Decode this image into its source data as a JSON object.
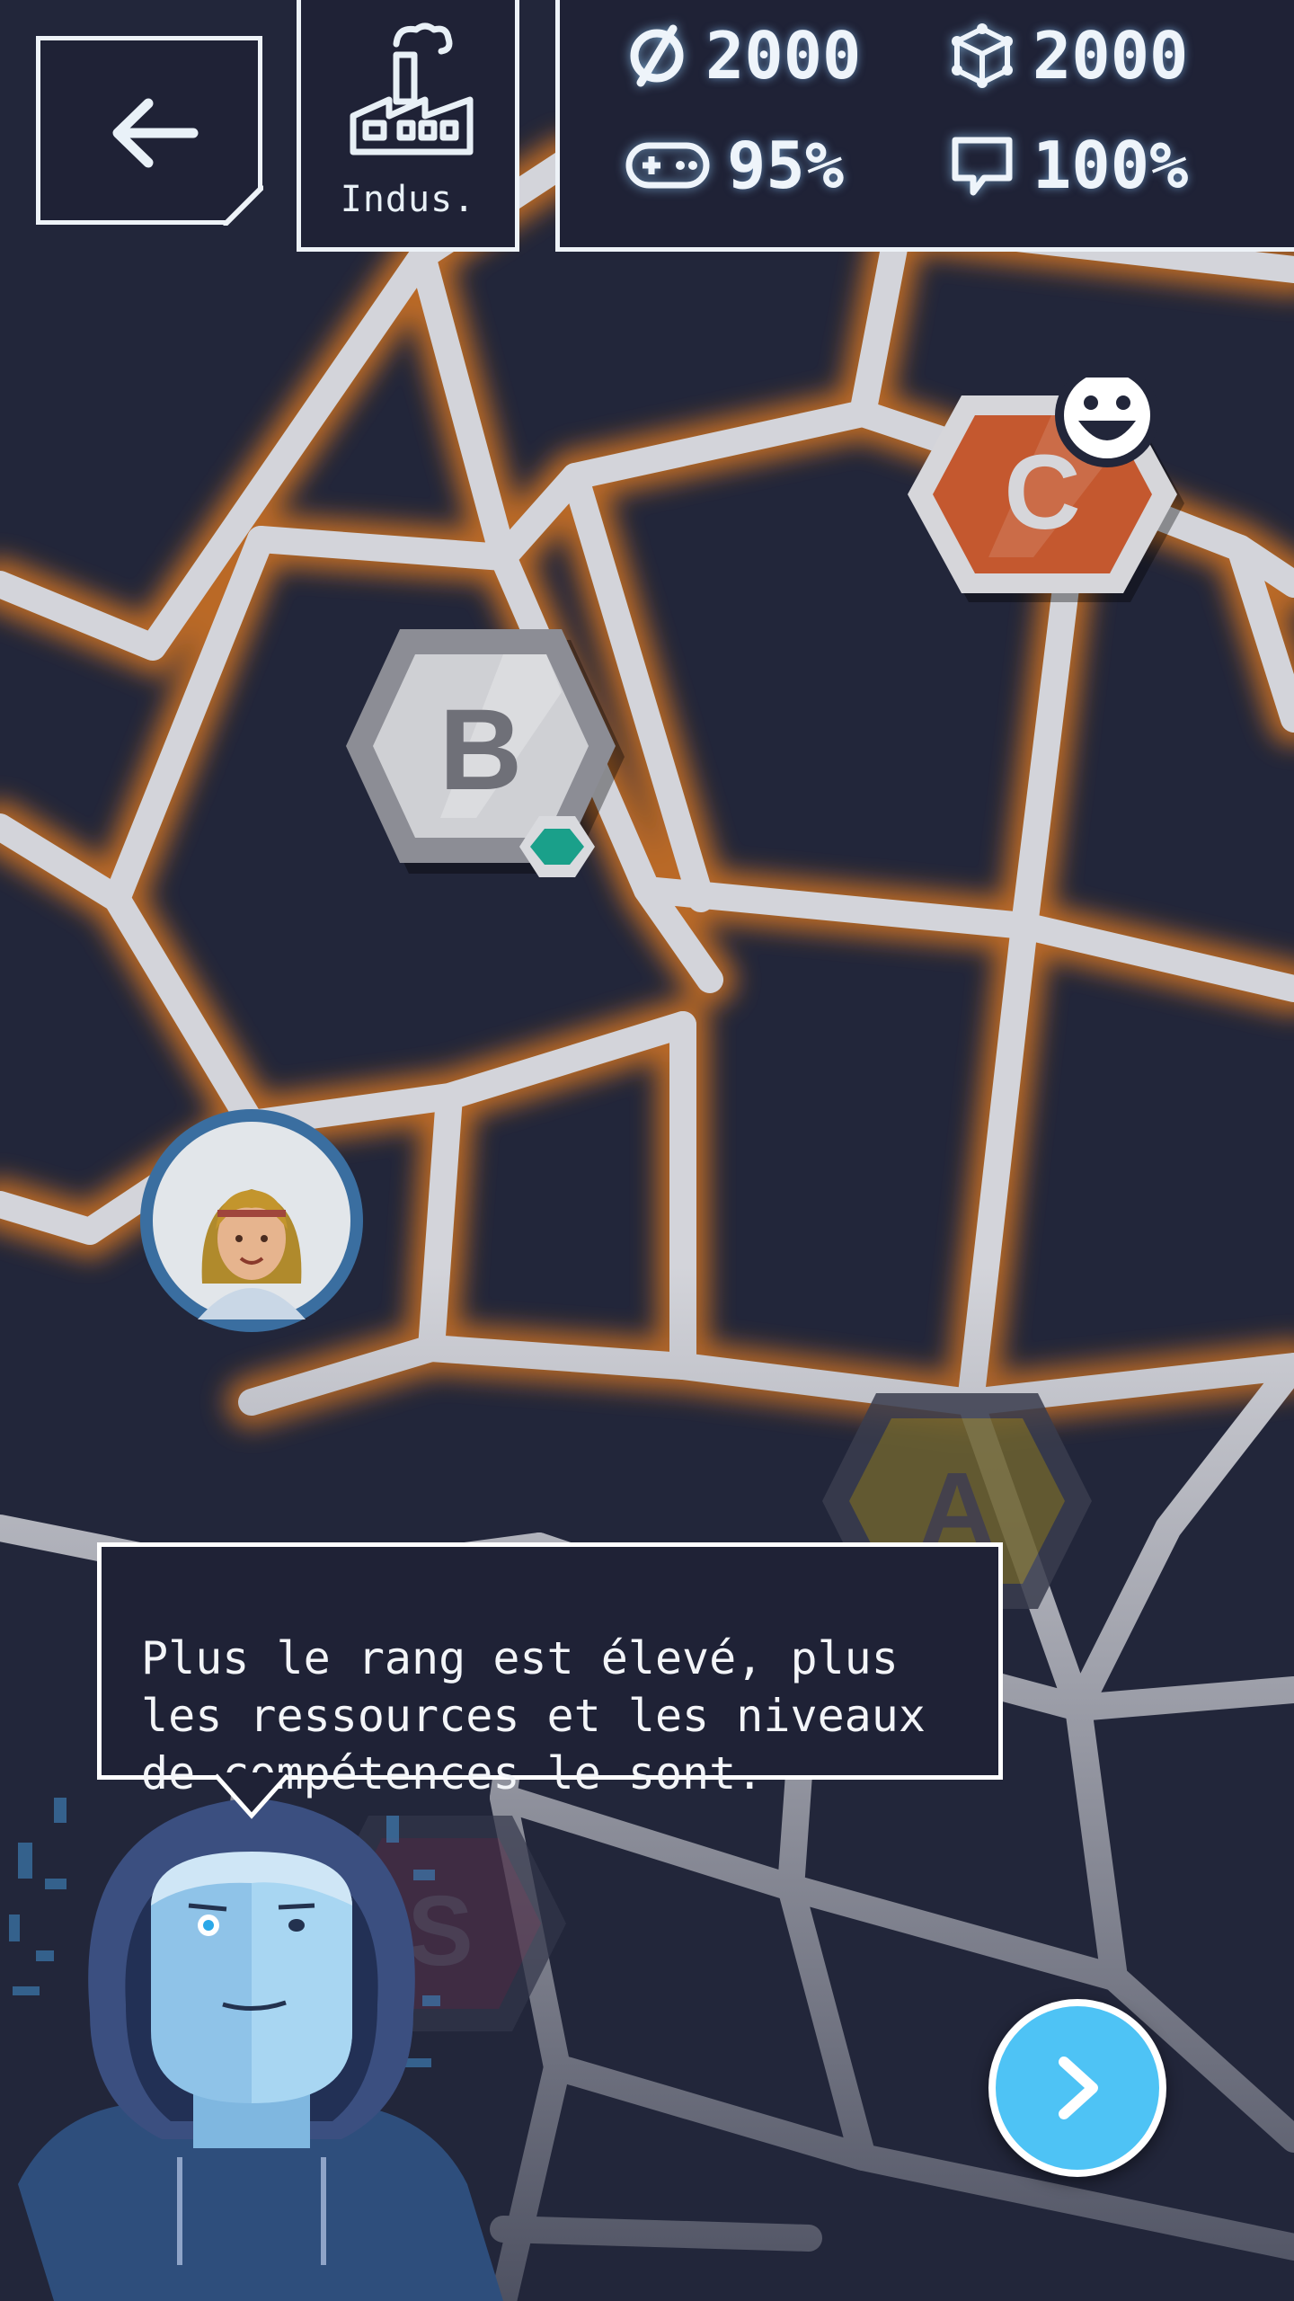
{
  "header": {
    "back_button_label": "back",
    "category_label": "Indus.",
    "category_icon": "factory-icon",
    "stats": {
      "currency": {
        "icon": "currency-icon",
        "value": "2000"
      },
      "resources": {
        "icon": "cube-icon",
        "value": "2000"
      },
      "fun": {
        "icon": "gamepad-icon",
        "value": "95%"
      },
      "communication": {
        "icon": "chat-bubble-icon",
        "value": "100%"
      }
    }
  },
  "map": {
    "nodes": [
      {
        "label": "C",
        "color": "#c4582f",
        "badge": "smiley-icon"
      },
      {
        "label": "B",
        "color": "#c9c9cc",
        "badge": "green-hexagon-badge"
      },
      {
        "label": "A",
        "color": "#8a7b2c"
      },
      {
        "label": "S",
        "color": "#5a2f4a"
      }
    ],
    "player_avatar": "avatar-woman"
  },
  "dialog": {
    "text": "Plus le rang est élevé, plus\nles ressources et les niveaux\nde compétences le sont."
  },
  "next_button_label": "next",
  "colors": {
    "background": "#22263a",
    "road": "#d8d9de",
    "glow": "#e07a20",
    "accent": "#4ec3f5"
  }
}
